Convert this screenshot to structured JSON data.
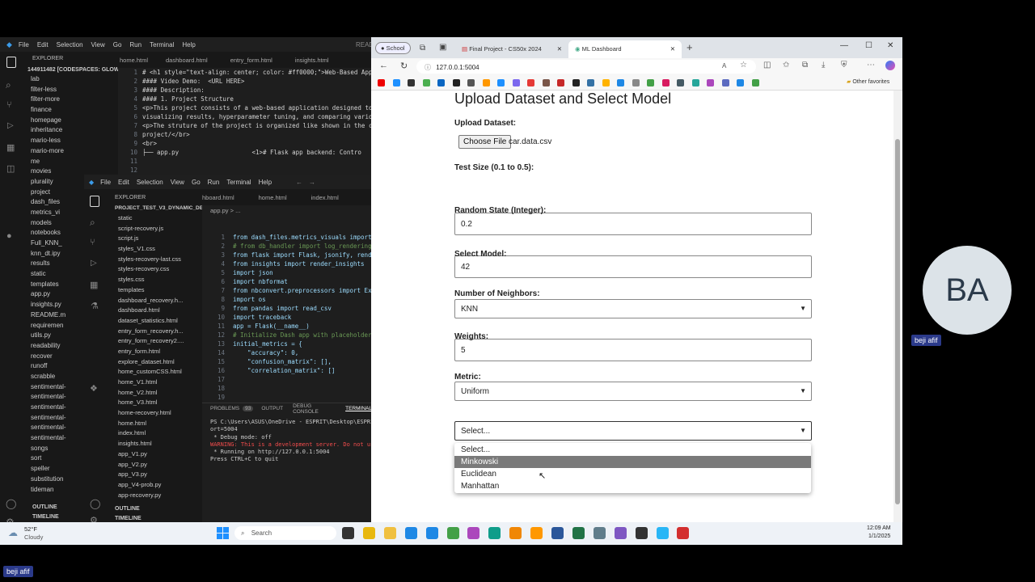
{
  "vscode_back": {
    "menu": [
      "File",
      "Edit",
      "Selection",
      "View",
      "Go",
      "Run",
      "Terminal",
      "Help"
    ],
    "read_label": "READ",
    "explorer_title": "EXPLORER",
    "root_folder": "144911482 [CODESPACES: GLOW...",
    "tabs": [
      "home.html",
      "dashboard.html",
      "entry_form.html",
      "insights.html"
    ],
    "tree": [
      "lab",
      "filter-less",
      "filter-more",
      "finance",
      "homepage",
      "inheritance",
      "mario-less",
      "mario-more",
      "me",
      "movies",
      "plurality",
      "project",
      "dash_files",
      "metrics_vi",
      "models",
      "notebooks",
      "Full_KNN_",
      "knn_dt.ipy",
      "results",
      "static",
      "templates",
      "app.py",
      "insights.py",
      "README.m",
      "requiremen",
      "utils.py",
      "readability",
      "recover",
      "runoff",
      "scrabble",
      "sentimental-",
      "sentimental-",
      "sentimental-",
      "sentimental-",
      "sentimental-",
      "sentimental-",
      "songs",
      "sort",
      "speller",
      "substitution",
      "tideman"
    ],
    "outline": "OUTLINE",
    "timeline": "TIMELINE",
    "code_lines": [
      "# <h1 style=\"text-align: center; color: #ff0000;\">Web-Based App",
      "#### Video Demo:  <URL HERE>",
      "#### Description:",
      "",
      "#### 1. Project Structure",
      "<p>This project consists of a web-based application designed to",
      "visualizing results, hyperparameter tuning, and comparing vario",
      "<p>The struture of the project is organized like shown in the c",
      "",
      "project/</br>",
      "<br>",
      "├── app.py                    <1># Flask app backend: Contro"
    ]
  },
  "vscode_front": {
    "menu": [
      "File",
      "Edit",
      "Selection",
      "View",
      "Go",
      "Run",
      "Terminal",
      "Help"
    ],
    "explorer_title": "EXPLORER",
    "root_folder": "PROJECT_TEST_V3_DYNAMIC_DE...",
    "tabs": [
      "hboard.html",
      "home.html",
      "index.html"
    ],
    "active_tab": "app.py",
    "breadcrumb": "app.py > ...",
    "tree": [
      "static",
      "script-recovery.js",
      "script.js",
      "styles_V1.css",
      "styles-recovery-last.css",
      "styles-recovery.css",
      "styles.css",
      "templates",
      "dashboard_recovery.h...",
      "dashboard.html",
      "dataset_statistics.html",
      "entry_form_recovery.h...",
      "entry_form_recovery2....",
      "entry_form.html",
      "explore_dataset.html",
      "home_customCSS.html",
      "home_V1.html",
      "home_V2.html",
      "home_V3.html",
      "home-recovery.html",
      "home.html",
      "index.html",
      "insights.html",
      "app_V1.py",
      "app_V2.py",
      "app_V3.py",
      "app_V4-prob.py",
      "app-recovery.py"
    ],
    "outline": "OUTLINE",
    "timeline": "TIMELINE",
    "code_lines": [
      "from dash_files.metrics_visuals import",
      "# from db_handler import log_rendering",
      "from flask import Flask, jsonify, rend",
      "from insights import render_insights",
      "import json",
      "import nbformat",
      "from nbconvert.preprocessors import Ex",
      "import os",
      "from pandas import read_csv",
      "import traceback",
      "",
      "",
      "app = Flask(__name__)",
      "",
      "# Initialize Dash app with placeholder",
      "initial_metrics = {",
      "    \"accuracy\": 0,",
      "    \"confusion_matrix\": [],",
      "    \"correlation_matrix\": []"
    ],
    "panel_tabs": [
      "PROBLEMS",
      "OUTPUT",
      "DEBUG CONSOLE",
      "TERMINAL"
    ],
    "problems_count": "93",
    "terminal_lines": [
      "PS C:\\Users\\ASUS\\OneDrive - ESPRIT\\Desktop\\ESPRIT",
      "ort=5004",
      " * Debug mode: off",
      "WARNING: This is a development server. Do not use",
      " * Running on http://127.0.0.1:5004",
      "Press CTRL+C to quit"
    ]
  },
  "browser": {
    "profile": "School",
    "tabs": [
      {
        "title": "Final Project - CS50x 2024"
      },
      {
        "title": "ML Dashboard"
      }
    ],
    "url": "127.0.0.1:5004",
    "other_favorites": "Other favorites"
  },
  "page": {
    "heading": "Upload Dataset and Select Model",
    "upload_label": "Upload Dataset:",
    "choose_file": "Choose File",
    "file_name": "car.data.csv",
    "test_size_label": "Test Size (0.1 to 0.5):",
    "test_size_value": "0.2",
    "random_state_label": "Random State (Integer):",
    "random_state_value": "42",
    "model_label": "Select Model:",
    "model_value": "KNN",
    "neighbors_label": "Number of Neighbors:",
    "neighbors_value": "5",
    "weights_label": "Weights:",
    "weights_value": "Uniform",
    "metric_label": "Metric:",
    "metric_value": "Select...",
    "metric_options": [
      "Select...",
      "Minkowski",
      "Euclidean",
      "Manhattan"
    ],
    "metric_highlighted_index": 1
  },
  "taskbar": {
    "weather_temp": "52°F",
    "weather_desc": "Cloudy",
    "search_placeholder": "Search",
    "time": "12:09 AM",
    "date": "1/1/2025"
  },
  "participant": {
    "initials": "BA",
    "name": "beji afif",
    "bottom_name": "beji afif"
  },
  "colors": {
    "highlight_option": "#7a7a7a",
    "avatar_bg": "#dce3e8",
    "name_tag": "#2b3a8a"
  }
}
